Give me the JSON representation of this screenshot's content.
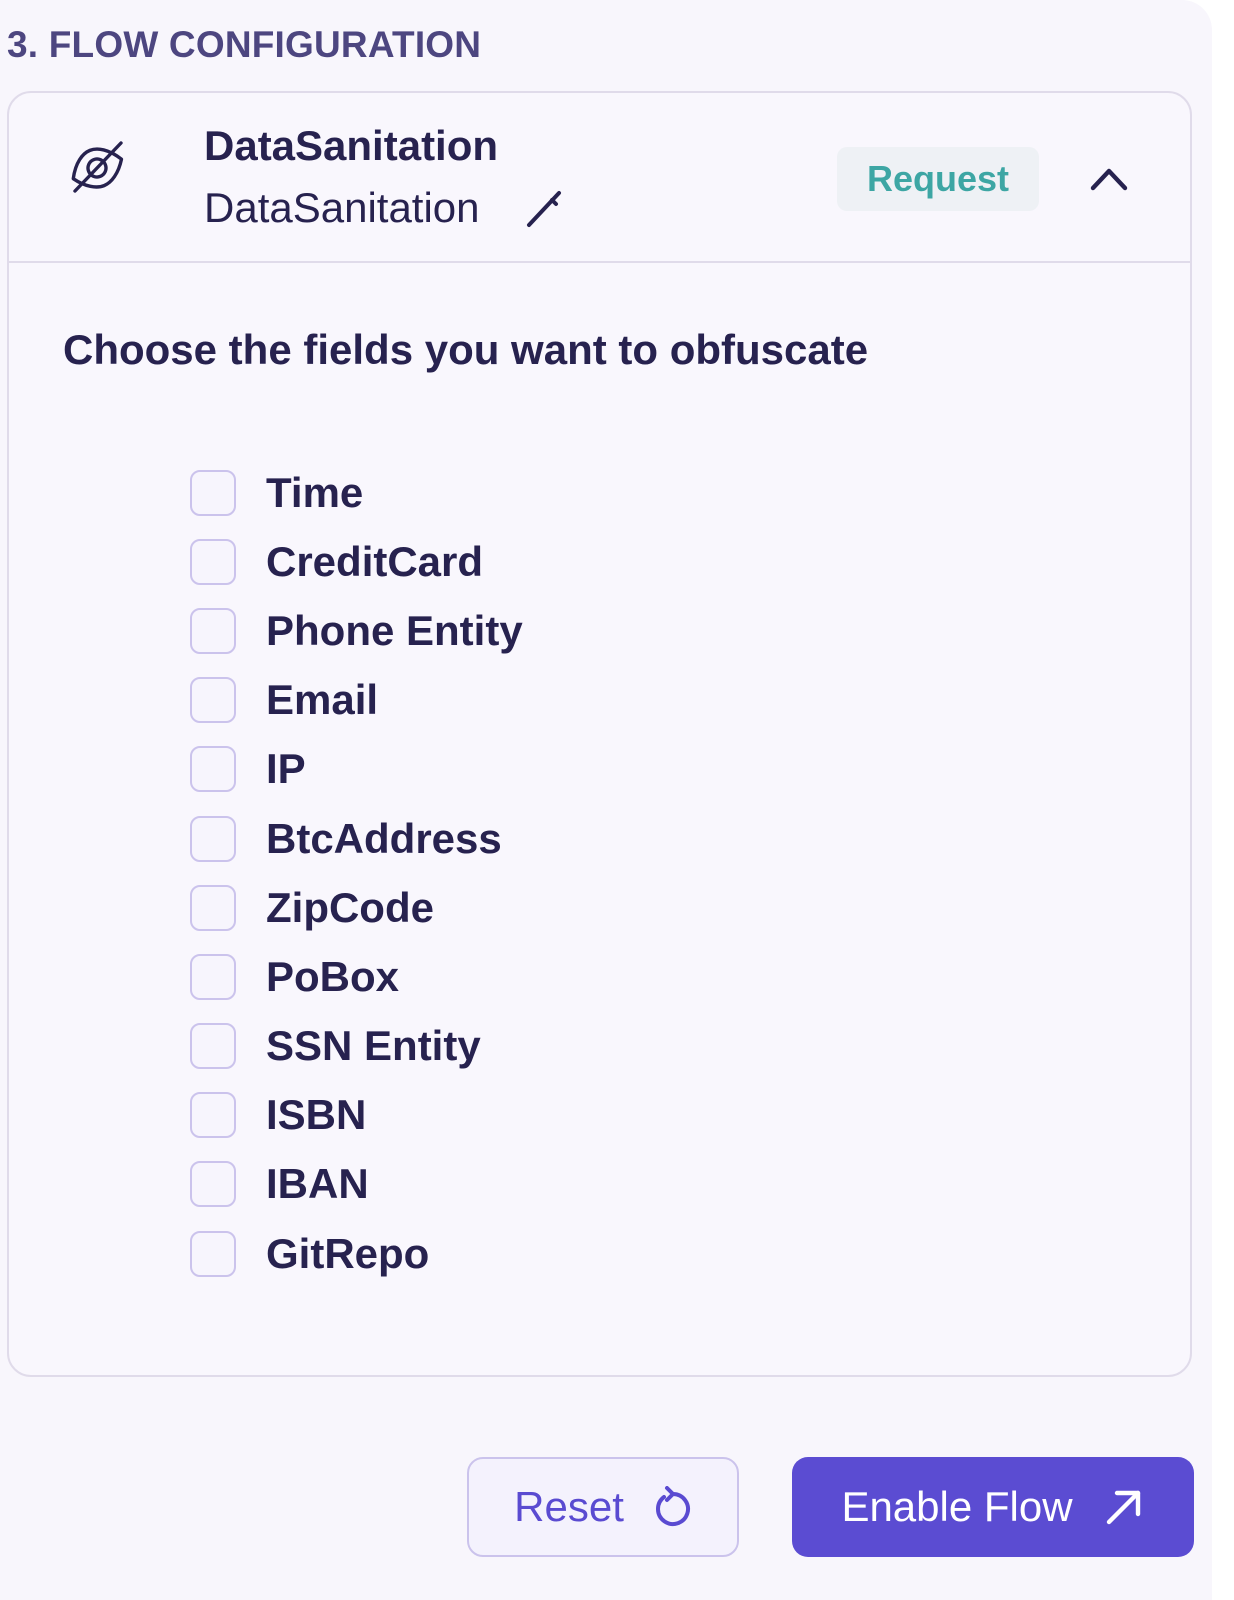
{
  "section": {
    "title": "3. FLOW CONFIGURATION"
  },
  "plugin": {
    "name": "DataSanitation",
    "subname": "DataSanitation",
    "badge": "Request",
    "icon": "eye-off-icon"
  },
  "fields": {
    "instruction": "Choose the fields you want to obfuscate",
    "items": [
      {
        "label": "Time",
        "checked": false
      },
      {
        "label": "CreditCard",
        "checked": false
      },
      {
        "label": "Phone Entity",
        "checked": false
      },
      {
        "label": "Email",
        "checked": false
      },
      {
        "label": "IP",
        "checked": false
      },
      {
        "label": "BtcAddress",
        "checked": false
      },
      {
        "label": "ZipCode",
        "checked": false
      },
      {
        "label": "PoBox",
        "checked": false
      },
      {
        "label": "SSN Entity",
        "checked": false
      },
      {
        "label": "ISBN",
        "checked": false
      },
      {
        "label": "IBAN",
        "checked": false
      },
      {
        "label": "GitRepo",
        "checked": false
      }
    ]
  },
  "actions": {
    "reset_label": "Reset",
    "enable_label": "Enable Flow"
  },
  "colors": {
    "accent": "#5b4cd2",
    "badge_text": "#3da6a4",
    "text_primary": "#27224f"
  }
}
